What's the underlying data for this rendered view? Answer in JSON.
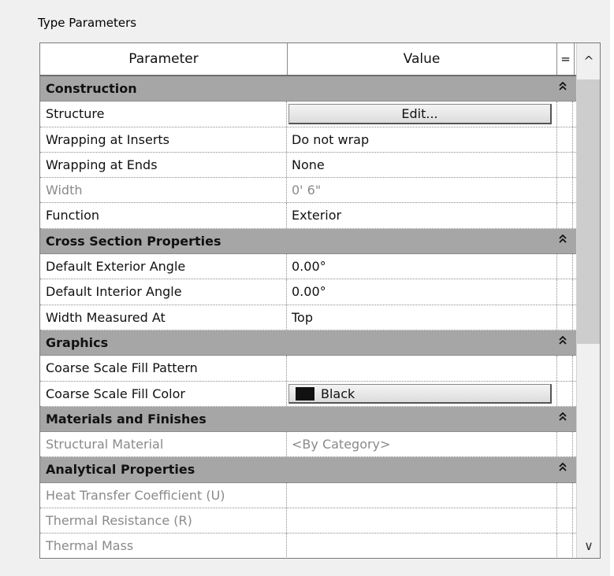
{
  "section_label": "Type Parameters",
  "header": {
    "parameter": "Parameter",
    "value": "Value",
    "equals": "="
  },
  "icons": {
    "collapse": "collapse-up-double-chevron-icon",
    "scroll_up": "chevron-up-icon",
    "scroll_down": "chevron-down-icon"
  },
  "rows": [
    {
      "type": "group",
      "label": "Construction",
      "collapse": "⌃"
    },
    {
      "type": "param",
      "label": "Structure",
      "button": "Edit...",
      "button_align": "center"
    },
    {
      "type": "param",
      "label": "Wrapping at Inserts",
      "value": "Do not wrap"
    },
    {
      "type": "param",
      "label": "Wrapping at Ends",
      "value": "None"
    },
    {
      "type": "param",
      "label": "Width",
      "value": "0'  6\"",
      "dim": true
    },
    {
      "type": "param",
      "label": "Function",
      "value": "Exterior"
    },
    {
      "type": "group",
      "label": "Cross Section Properties",
      "collapse": "⌃"
    },
    {
      "type": "param",
      "label": "Default Exterior Angle",
      "value": "0.00°"
    },
    {
      "type": "param",
      "label": "Default Interior Angle",
      "value": "0.00°"
    },
    {
      "type": "param",
      "label": "Width Measured At",
      "value": "Top"
    },
    {
      "type": "group",
      "label": "Graphics",
      "collapse": "⌃"
    },
    {
      "type": "param",
      "label": "Coarse Scale Fill Pattern",
      "value": ""
    },
    {
      "type": "param",
      "label": "Coarse Scale Fill Color",
      "button": "Black",
      "button_align": "left",
      "swatch": "#111111"
    },
    {
      "type": "group",
      "label": "Materials and Finishes",
      "collapse": "⌃"
    },
    {
      "type": "param",
      "label": "Structural Material",
      "value": "<By Category>",
      "dim": true
    },
    {
      "type": "group",
      "label": "Analytical Properties",
      "collapse": "⌃"
    },
    {
      "type": "param",
      "label": "Heat Transfer Coefficient (U)",
      "value": "",
      "dim": true
    },
    {
      "type": "param",
      "label": "Thermal Resistance (R)",
      "value": "",
      "dim": true
    },
    {
      "type": "param",
      "label": "Thermal Mass",
      "value": "",
      "dim": true
    }
  ],
  "scrollbar": {
    "up": "^",
    "down": "∨",
    "thumb_position": 0.0,
    "thumb_fraction": 0.52
  }
}
